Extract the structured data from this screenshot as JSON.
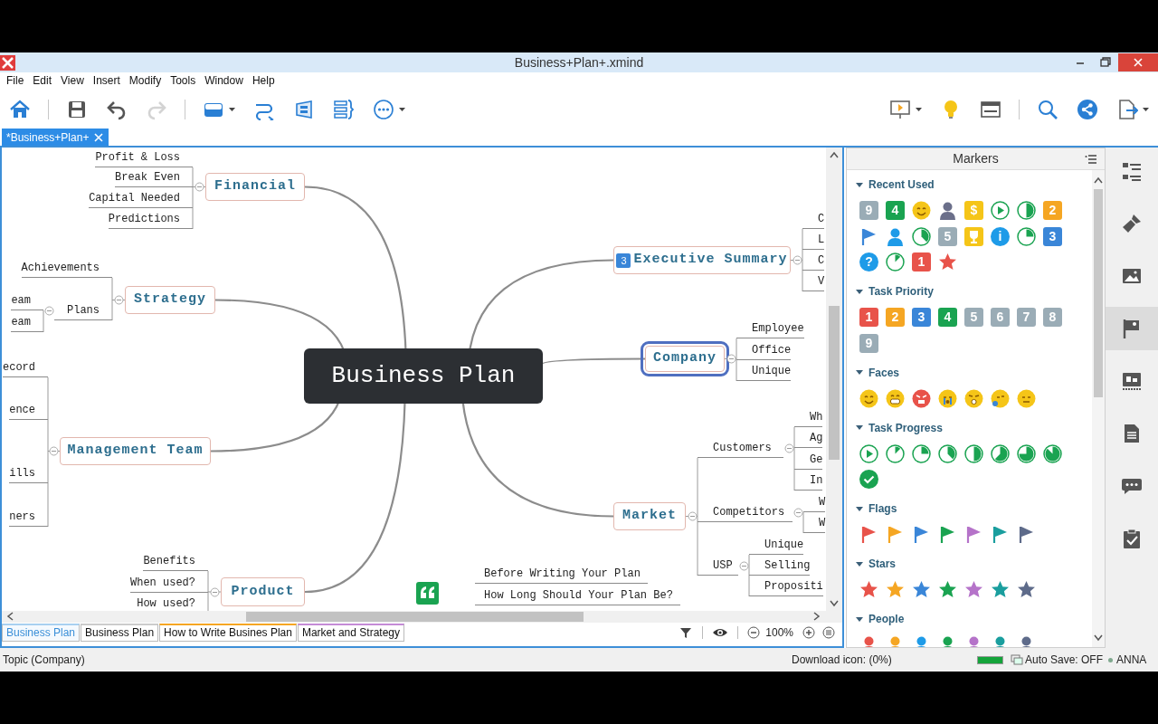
{
  "window": {
    "title": "Business+Plan+.xmind"
  },
  "menu": [
    "File",
    "Edit",
    "View",
    "Insert",
    "Modify",
    "Tools",
    "Window",
    "Help"
  ],
  "toolbar": {
    "left": [
      {
        "kind": "home",
        "disabled": false,
        "dropdown": false
      },
      {
        "kind": "separator"
      },
      {
        "kind": "save",
        "disabled": false,
        "dropdown": false
      },
      {
        "kind": "undo",
        "disabled": false,
        "dropdown": false
      },
      {
        "kind": "redo",
        "disabled": true,
        "dropdown": false
      },
      {
        "kind": "separator"
      },
      {
        "kind": "topic",
        "disabled": false,
        "dropdown": true
      },
      {
        "kind": "relationship",
        "disabled": false,
        "dropdown": false
      },
      {
        "kind": "boundary",
        "disabled": false,
        "dropdown": false
      },
      {
        "kind": "summary",
        "disabled": false,
        "dropdown": false
      },
      {
        "kind": "more",
        "disabled": false,
        "dropdown": true
      }
    ],
    "right": [
      {
        "kind": "presentation",
        "disabled": false,
        "dropdown": true
      },
      {
        "kind": "idea",
        "disabled": false,
        "dropdown": false
      },
      {
        "kind": "window",
        "disabled": false,
        "dropdown": false
      },
      {
        "kind": "separator"
      },
      {
        "kind": "search",
        "disabled": false,
        "dropdown": false
      },
      {
        "kind": "share",
        "disabled": false,
        "dropdown": false
      },
      {
        "kind": "export",
        "disabled": false,
        "dropdown": true
      }
    ]
  },
  "document_tab": {
    "label": "*Business+Plan+"
  },
  "mind_map": {
    "central": "Business Plan",
    "topics": [
      {
        "label": "Financial",
        "selected": false,
        "expanded": true,
        "children": [
          {
            "label": "Profit & Loss"
          },
          {
            "label": "Break Even"
          },
          {
            "label": "Capital Needed"
          },
          {
            "label": "Predictions"
          }
        ]
      },
      {
        "label": "Executive Summary",
        "selected": false,
        "expanded": true,
        "marker": "3",
        "children": [
          {
            "label": "C"
          },
          {
            "label": "L"
          },
          {
            "label": "C"
          },
          {
            "label": "V"
          }
        ]
      },
      {
        "label": "Strategy",
        "selected": false,
        "expanded": true,
        "children": [
          {
            "label": "Achievements"
          },
          {
            "label": "Plans",
            "expanded": true,
            "children": [
              {
                "label": "eam"
              },
              {
                "label": "eam"
              }
            ]
          }
        ]
      },
      {
        "label": "Company",
        "selected": true,
        "expanded": true,
        "children": [
          {
            "label": "Employee"
          },
          {
            "label": "Office"
          },
          {
            "label": "Unique"
          }
        ]
      },
      {
        "label": "Management Team",
        "selected": false,
        "expanded": true,
        "children": [
          {
            "label": "ecord"
          },
          {
            "label": "ence"
          },
          {
            "label": "ills"
          },
          {
            "label": "ners"
          }
        ]
      },
      {
        "label": "Market",
        "selected": false,
        "expanded": true,
        "children": [
          {
            "label": "Customers",
            "expanded": true,
            "children": [
              {
                "label": "Wh"
              },
              {
                "label": "Ag"
              },
              {
                "label": "Ge"
              },
              {
                "label": "In"
              }
            ]
          },
          {
            "label": "Competitors",
            "expanded": true,
            "children": [
              {
                "label": "W"
              },
              {
                "label": "W"
              }
            ]
          },
          {
            "label": "USP",
            "expanded": true,
            "children": [
              {
                "label": "Unique"
              },
              {
                "label": "Selling"
              },
              {
                "label": "Propositi"
              }
            ]
          }
        ]
      },
      {
        "label": "Product",
        "selected": false,
        "expanded": true,
        "children": [
          {
            "label": "Benefits"
          },
          {
            "label": "When used?"
          },
          {
            "label": "How used?"
          }
        ]
      }
    ],
    "floating": {
      "lines": [
        "Before Writing Your Plan",
        "How Long Should Your Plan Be?"
      ]
    }
  },
  "sheets": [
    {
      "label": "Business Plan",
      "selected": true,
      "color": "#a8d0f0"
    },
    {
      "label": "Business Plan",
      "selected": false,
      "color": "#cccccc"
    },
    {
      "label": "How to Write Busines Plan",
      "selected": false,
      "color": "#f5a623"
    },
    {
      "label": "Market and Strategy",
      "selected": false,
      "color": "#c58bd6"
    }
  ],
  "view_controls": {
    "zoom": "100%"
  },
  "markers": {
    "title": "Markers",
    "sections": [
      {
        "title": "Recent Used",
        "expanded": true,
        "items": [
          {
            "kind": "number",
            "label": "9",
            "color": "#9aacb6"
          },
          {
            "kind": "number",
            "label": "4",
            "color": "#1aa351"
          },
          {
            "kind": "smile",
            "color": "#f5c518"
          },
          {
            "kind": "person",
            "color": "#6b6f8a"
          },
          {
            "kind": "number",
            "label": "$",
            "color": "#f5c518"
          },
          {
            "kind": "start"
          },
          {
            "kind": "half"
          },
          {
            "kind": "number",
            "label": "2",
            "color": "#f5a623"
          },
          {
            "kind": "flag",
            "color": "#3a86d8"
          },
          {
            "kind": "person",
            "color": "#1e9be8"
          },
          {
            "kind": "threeeighths"
          },
          {
            "kind": "number",
            "label": "5",
            "color": "#9aacb6"
          },
          {
            "kind": "trophy",
            "color": "#f5c518"
          },
          {
            "kind": "round",
            "label": "i",
            "color": "#1e9be8"
          },
          {
            "kind": "quarter"
          },
          {
            "kind": "number",
            "label": "3",
            "color": "#3a86d8"
          },
          {
            "kind": "round",
            "label": "?",
            "color": "#1e9be8"
          },
          {
            "kind": "eighth"
          },
          {
            "kind": "number",
            "label": "1",
            "color": "#e8534a"
          },
          {
            "kind": "star",
            "color": "#e8534a"
          }
        ]
      },
      {
        "title": "Task Priority",
        "expanded": true,
        "items": [
          {
            "kind": "number",
            "label": "1",
            "color": "#e8534a"
          },
          {
            "kind": "number",
            "label": "2",
            "color": "#f5a623"
          },
          {
            "kind": "number",
            "label": "3",
            "color": "#3a86d8"
          },
          {
            "kind": "number",
            "label": "4",
            "color": "#1aa351"
          },
          {
            "kind": "number",
            "label": "5",
            "color": "#9aacb6"
          },
          {
            "kind": "number",
            "label": "6",
            "color": "#9aacb6"
          },
          {
            "kind": "number",
            "label": "7",
            "color": "#9aacb6"
          },
          {
            "kind": "number",
            "label": "8",
            "color": "#9aacb6"
          },
          {
            "kind": "number",
            "label": "9",
            "color": "#9aacb6"
          }
        ]
      },
      {
        "title": "Faces",
        "expanded": true,
        "items": [
          {
            "kind": "smile",
            "color": "#f5c518"
          },
          {
            "kind": "grin",
            "color": "#f5c518"
          },
          {
            "kind": "angry",
            "color": "#e8534a"
          },
          {
            "kind": "cry",
            "color": "#f5c518"
          },
          {
            "kind": "shocked",
            "color": "#f5c518"
          },
          {
            "kind": "sleepy",
            "color": "#f5c518"
          },
          {
            "kind": "neutral",
            "color": "#f5c518"
          }
        ]
      },
      {
        "title": "Task Progress",
        "expanded": true,
        "items": [
          {
            "kind": "start"
          },
          {
            "kind": "eighth"
          },
          {
            "kind": "quarter"
          },
          {
            "kind": "threeeighths"
          },
          {
            "kind": "half"
          },
          {
            "kind": "fiveeighths"
          },
          {
            "kind": "threequarters"
          },
          {
            "kind": "seveneighths"
          },
          {
            "kind": "done"
          }
        ]
      },
      {
        "title": "Flags",
        "expanded": true,
        "items": [
          {
            "kind": "flag",
            "color": "#e8534a"
          },
          {
            "kind": "flag",
            "color": "#f5a623"
          },
          {
            "kind": "flag",
            "color": "#3a86d8"
          },
          {
            "kind": "flag",
            "color": "#1aa351"
          },
          {
            "kind": "flag",
            "color": "#b573c9"
          },
          {
            "kind": "flag",
            "color": "#1a9e9e"
          },
          {
            "kind": "flag",
            "color": "#5e6b8a"
          }
        ]
      },
      {
        "title": "Stars",
        "expanded": true,
        "items": [
          {
            "kind": "star",
            "color": "#e8534a"
          },
          {
            "kind": "star",
            "color": "#f5a623"
          },
          {
            "kind": "star",
            "color": "#3a86d8"
          },
          {
            "kind": "star",
            "color": "#1aa351"
          },
          {
            "kind": "star",
            "color": "#b573c9"
          },
          {
            "kind": "star",
            "color": "#1a9e9e"
          },
          {
            "kind": "star",
            "color": "#5e6b8a"
          }
        ]
      },
      {
        "title": "People",
        "expanded": true,
        "items": [
          {
            "kind": "person",
            "color": "#e8534a"
          },
          {
            "kind": "person",
            "color": "#f5a623"
          },
          {
            "kind": "person",
            "color": "#1e9be8"
          },
          {
            "kind": "person",
            "color": "#1aa351"
          },
          {
            "kind": "person",
            "color": "#b573c9"
          },
          {
            "kind": "person",
            "color": "#1a9e9e"
          },
          {
            "kind": "person",
            "color": "#5e6b8a"
          }
        ]
      }
    ]
  },
  "side_tabs": [
    {
      "kind": "outline",
      "selected": false
    },
    {
      "kind": "format",
      "selected": false
    },
    {
      "kind": "image",
      "selected": false
    },
    {
      "kind": "markers",
      "selected": true
    },
    {
      "kind": "text",
      "selected": false
    },
    {
      "kind": "notes",
      "selected": false
    },
    {
      "kind": "comments",
      "selected": false
    },
    {
      "kind": "task",
      "selected": false
    }
  ],
  "status_bar": {
    "topic": "Topic (Company)",
    "download": "Download icon: (0%)",
    "memory": {
      "level": 1
    },
    "auto_save": "Auto Save: OFF",
    "user": "ANNA"
  }
}
